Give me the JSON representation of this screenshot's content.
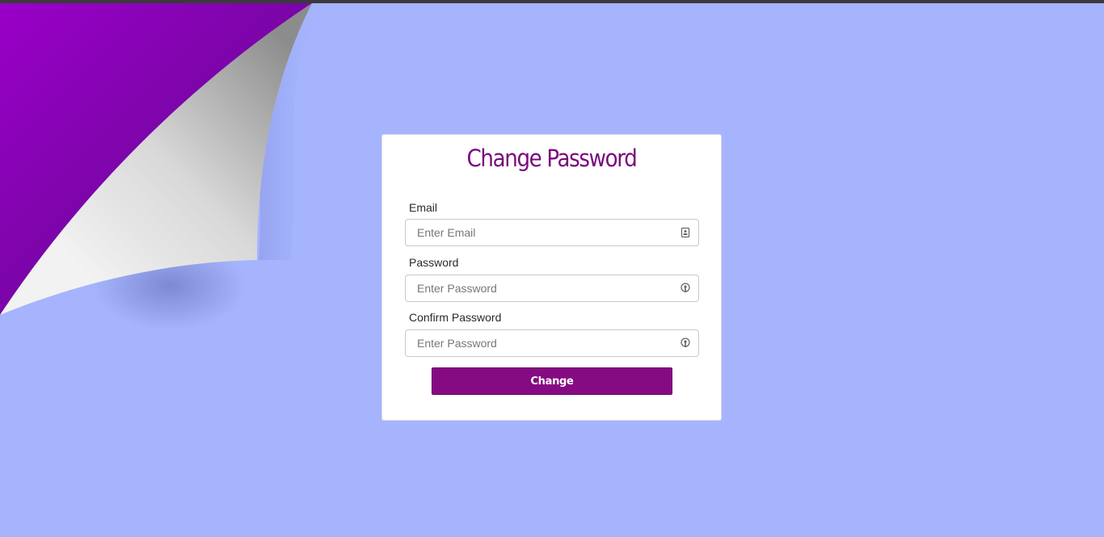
{
  "colors": {
    "background": "#a5b4fd",
    "accent": "#860b82",
    "title": "#7a0a7c",
    "curl_purple": "#8b00c0"
  },
  "form": {
    "title": "Change Password",
    "fields": [
      {
        "label": "Email",
        "placeholder": "Enter Email",
        "value": "",
        "icon": "contact-card-icon"
      },
      {
        "label": "Password",
        "placeholder": "Enter Password",
        "value": "",
        "icon": "key-icon"
      },
      {
        "label": "Confirm Password",
        "placeholder": "Enter Password",
        "value": "",
        "icon": "key-icon"
      }
    ],
    "submit_label": "Change"
  }
}
